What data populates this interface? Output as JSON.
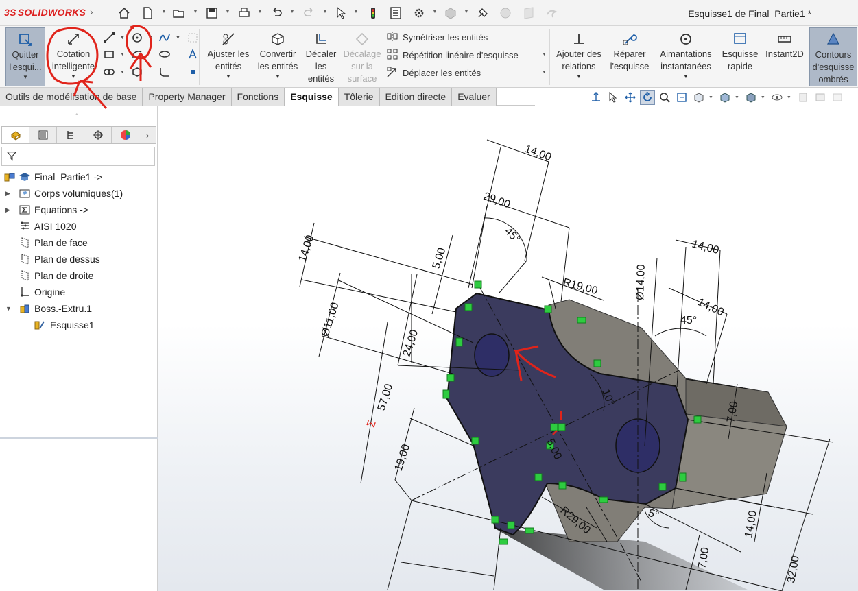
{
  "app": {
    "logo_text": "SOLIDWORKS",
    "document_title": "Esquisse1 de Final_Partie1 *"
  },
  "ribbon": {
    "quit_sketch": {
      "line1": "Quitter",
      "line2": "l'esqui..."
    },
    "smart_dimension": {
      "line1": "Cotation",
      "line2": "intelligente"
    },
    "trim": {
      "line1": "Ajuster les",
      "line2": "entités"
    },
    "convert": {
      "line1": "Convertir",
      "line2": "les entités"
    },
    "offset": {
      "line1": "Décaler",
      "line2": "les",
      "line3": "entités"
    },
    "offset_surface": {
      "line1": "Décalage",
      "line2": "sur la",
      "line3": "surface"
    },
    "mirror": "Symétriser les entités",
    "linear_pattern": "Répétition linéaire d'esquisse",
    "move": "Déplacer les entités",
    "add_relations": {
      "line1": "Ajouter des",
      "line2": "relations"
    },
    "repair": {
      "line1": "Réparer",
      "line2": "l'esquisse"
    },
    "snaps": {
      "line1": "Aimantations",
      "line2": "instantanées"
    },
    "rapid_sketch": {
      "line1": "Esquisse",
      "line2": "rapide"
    },
    "instant2d": "Instant2D",
    "shaded_contours": {
      "line1": "Contours",
      "line2": "d'esquisse",
      "line3": "ombrés"
    }
  },
  "tabs": [
    "Outils de modélisation de base",
    "Property Manager",
    "Fonctions",
    "Esquisse",
    "Tôlerie",
    "Edition directe",
    "Evaluer"
  ],
  "active_tab": "Esquisse",
  "tree": {
    "root": "Final_Partie1 ->",
    "items": [
      "Corps volumiques(1)",
      "Equations ->",
      "AISI 1020",
      "Plan de face",
      "Plan de dessus",
      "Plan de droite",
      "Origine",
      "Boss.-Extru.1",
      "Esquisse1"
    ]
  },
  "dimensions": {
    "d1": "14,00",
    "d2": "29,00",
    "d3": "45°",
    "d4": "14,00",
    "d5": "5,00",
    "d6": "Ø11,00",
    "d7": "24,00",
    "d8": "57,00",
    "d9": "19,00",
    "d10": "R19,00",
    "d11": "Ø14,00",
    "d12": "14,00",
    "d13": "14,00",
    "d14": "45°",
    "d15": "10°",
    "d16": "7,00",
    "d17": "5,00",
    "d18": "R29,00",
    "d19": "14,00",
    "d20": "7,00",
    "d21": "32,00",
    "d22": "5°",
    "d23": "Σ"
  },
  "colors": {
    "annotation": "#e0241b",
    "sketch_face": "#3b3b5e",
    "solid": "#7d7a72",
    "relation": "#2ecc40",
    "ribbon_active": "#aeb9c8"
  }
}
